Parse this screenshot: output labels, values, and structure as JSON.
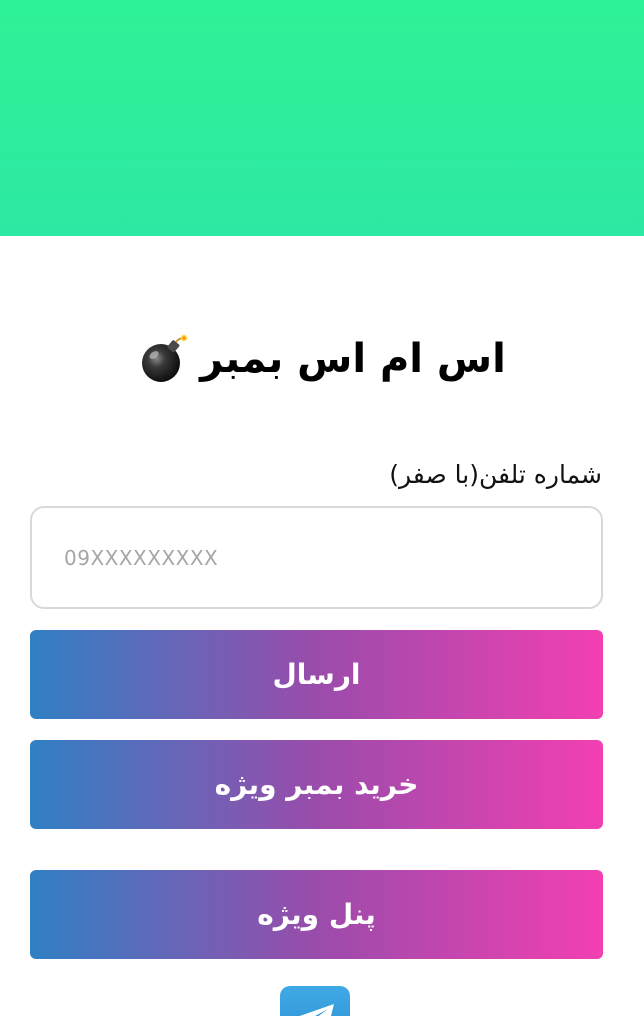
{
  "header": {
    "title": "اس ام اس بمبر",
    "title_icon": "bomb-icon"
  },
  "form": {
    "phone_label": "شماره تلفن(با صفر)",
    "phone_placeholder": "09XXXXXXXXX",
    "phone_value": ""
  },
  "buttons": {
    "send": "ارسال",
    "buy_bomber": "خرید بمبر ویژه",
    "vip_panel": "پنل ویژه"
  },
  "footer": {
    "icon": "telegram-icon"
  },
  "colors": {
    "banner_top": "#2ef296",
    "banner_bottom": "#2de8a3",
    "button_gradient_start": "#3080c4",
    "button_gradient_end": "#f33fb2",
    "telegram_blue": "#2b8dcf"
  }
}
